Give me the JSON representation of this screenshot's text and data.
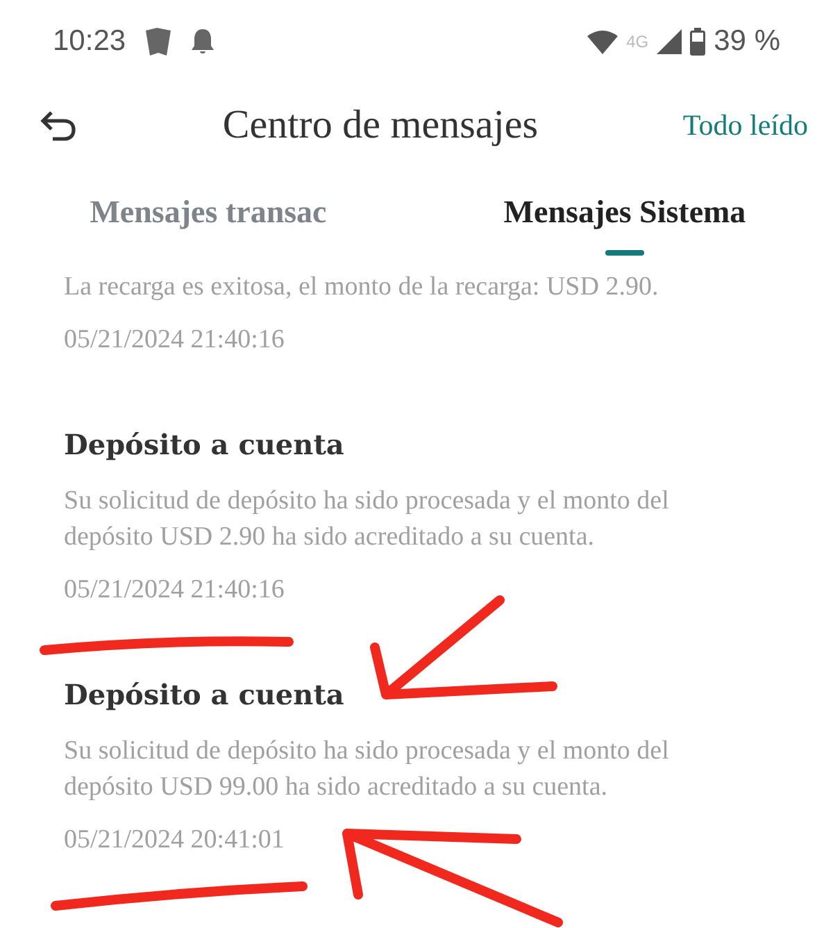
{
  "status_bar": {
    "time": "10:23",
    "network": "4G",
    "battery": "39 %"
  },
  "header": {
    "title": "Centro de mensajes",
    "action": "Todo leído"
  },
  "tabs": [
    {
      "label": "Mensajes transac",
      "selected": false
    },
    {
      "label": "Mensajes Sistema",
      "selected": true
    }
  ],
  "messages": [
    {
      "body": "La recarga es exitosa, el monto de la recarga: USD 2.90.",
      "date": "05/21/2024 21:40:16"
    },
    {
      "title": "Depósito a cuenta",
      "body": "Su solicitud de depósito ha sido procesada y el monto del depósito USD 2.90 ha sido acreditado a su cuenta.",
      "date": "05/21/2024 21:40:16"
    },
    {
      "title": "Depósito a cuenta",
      "body": "Su solicitud de depósito ha sido procesada y el monto del depósito USD 99.00 ha sido acreditado a su cuenta.",
      "date": "05/21/2024 20:41:01"
    }
  ]
}
